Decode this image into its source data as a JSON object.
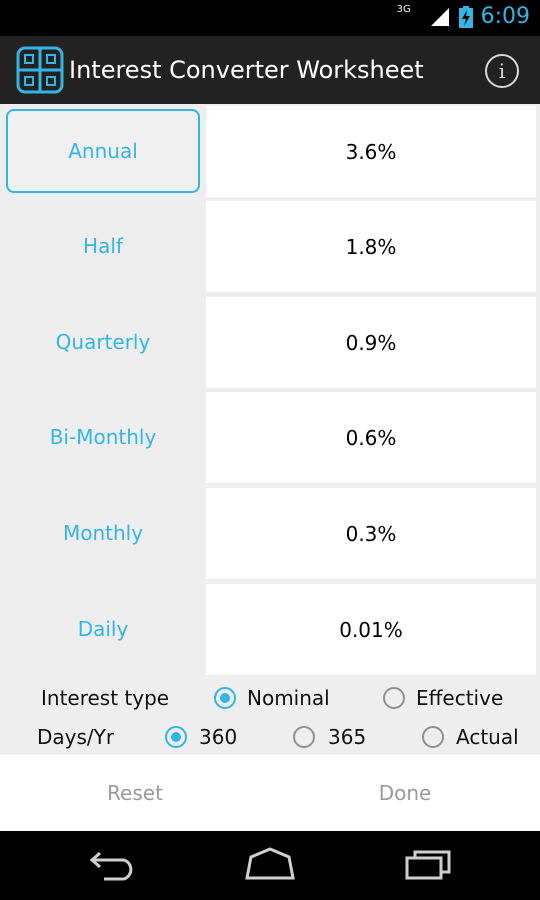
{
  "status_bar": {
    "network": "3G",
    "time": "6:09"
  },
  "action_bar": {
    "title": "Interest Converter Worksheet",
    "info_label": "i"
  },
  "frequencies": [
    {
      "label": "Annual",
      "rate": "3.6%",
      "selected": true
    },
    {
      "label": "Half",
      "rate": "1.8%",
      "selected": false
    },
    {
      "label": "Quarterly",
      "rate": "0.9%",
      "selected": false
    },
    {
      "label": "Bi-Monthly",
      "rate": "0.6%",
      "selected": false
    },
    {
      "label": "Monthly",
      "rate": "0.3%",
      "selected": false
    },
    {
      "label": "Daily",
      "rate": "0.01%",
      "selected": false
    }
  ],
  "interest_type": {
    "label": "Interest type",
    "options": [
      {
        "label": "Nominal",
        "checked": true
      },
      {
        "label": "Effective",
        "checked": false
      }
    ]
  },
  "days_per_year": {
    "label": "Days/Yr",
    "options": [
      {
        "label": "360",
        "checked": true
      },
      {
        "label": "365",
        "checked": false
      },
      {
        "label": "Actual",
        "checked": false
      }
    ]
  },
  "footer": {
    "reset_label": "Reset",
    "done_label": "Done"
  },
  "colors": {
    "accent": "#33b5e5",
    "action_bar": "#222222"
  }
}
